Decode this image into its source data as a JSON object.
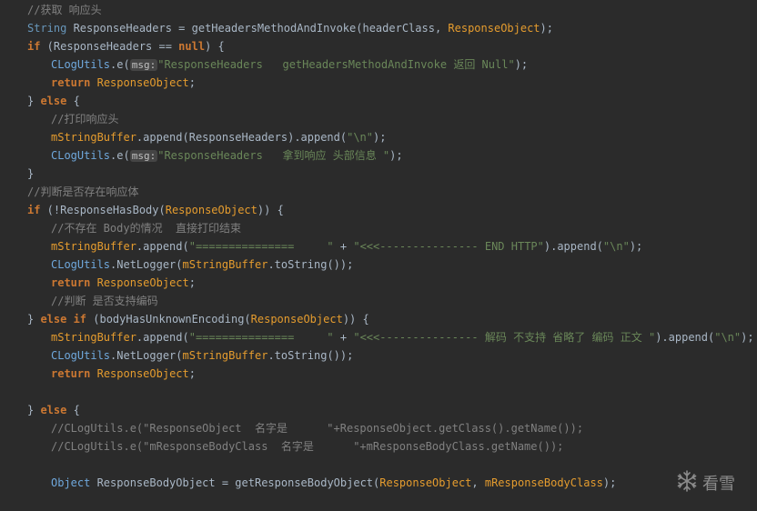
{
  "lines": [
    {
      "ind": 1,
      "tokens": [
        {
          "c": "comment",
          "t": "//获取 响应头"
        }
      ]
    },
    {
      "ind": 1,
      "tokens": [
        {
          "c": "type",
          "t": "String"
        },
        {
          "c": "plain",
          "t": " ResponseHeaders = getHeadersMethodAndInvoke(headerClass, "
        },
        {
          "c": "member",
          "t": "ResponseObject"
        },
        {
          "c": "plain",
          "t": ");"
        }
      ]
    },
    {
      "ind": 1,
      "tokens": [
        {
          "c": "kw",
          "t": "if"
        },
        {
          "c": "plain",
          "t": " (ResponseHeaders == "
        },
        {
          "c": "kw",
          "t": "null"
        },
        {
          "c": "plain",
          "t": ") {"
        }
      ]
    },
    {
      "ind": 2,
      "tokens": [
        {
          "c": "class",
          "t": "CLogUtils"
        },
        {
          "c": "plain",
          "t": ".e("
        },
        {
          "c": "hint",
          "t": "msg:"
        },
        {
          "c": "str",
          "t": "\"ResponseHeaders   getHeadersMethodAndInvoke 返回 Null\""
        },
        {
          "c": "plain",
          "t": ");"
        }
      ]
    },
    {
      "ind": 2,
      "tokens": [
        {
          "c": "kw",
          "t": "return"
        },
        {
          "c": "plain",
          "t": " "
        },
        {
          "c": "member",
          "t": "ResponseObject"
        },
        {
          "c": "plain",
          "t": ";"
        }
      ]
    },
    {
      "ind": 1,
      "tokens": [
        {
          "c": "plain",
          "t": "} "
        },
        {
          "c": "kw",
          "t": "else"
        },
        {
          "c": "plain",
          "t": " {"
        }
      ]
    },
    {
      "ind": 2,
      "tokens": [
        {
          "c": "comment",
          "t": "//打印响应头"
        }
      ]
    },
    {
      "ind": 2,
      "tokens": [
        {
          "c": "member",
          "t": "mStringBuffer"
        },
        {
          "c": "plain",
          "t": ".append(ResponseHeaders).append("
        },
        {
          "c": "str",
          "t": "\"\\n\""
        },
        {
          "c": "plain",
          "t": ");"
        }
      ]
    },
    {
      "ind": 2,
      "tokens": [
        {
          "c": "class",
          "t": "CLogUtils"
        },
        {
          "c": "plain",
          "t": ".e("
        },
        {
          "c": "hint",
          "t": "msg:"
        },
        {
          "c": "str",
          "t": "\"ResponseHeaders   拿到响应 头部信息 \""
        },
        {
          "c": "plain",
          "t": ");"
        }
      ]
    },
    {
      "ind": 1,
      "tokens": [
        {
          "c": "plain",
          "t": "}"
        }
      ]
    },
    {
      "ind": 1,
      "tokens": [
        {
          "c": "comment",
          "t": "//判断是否存在响应体"
        }
      ]
    },
    {
      "ind": 1,
      "tokens": [
        {
          "c": "kw",
          "t": "if"
        },
        {
          "c": "plain",
          "t": " (!ResponseHasBody("
        },
        {
          "c": "member",
          "t": "ResponseObject"
        },
        {
          "c": "plain",
          "t": ")) {"
        }
      ]
    },
    {
      "ind": 2,
      "tokens": [
        {
          "c": "comment",
          "t": "//不存在 Body的情况  直接打印结束"
        }
      ]
    },
    {
      "ind": 2,
      "tokens": [
        {
          "c": "member",
          "t": "mStringBuffer"
        },
        {
          "c": "plain",
          "t": ".append("
        },
        {
          "c": "str",
          "t": "\"===============     \""
        },
        {
          "c": "plain",
          "t": " + "
        },
        {
          "c": "str",
          "t": "\"<<<--------------- END HTTP\""
        },
        {
          "c": "plain",
          "t": ").append("
        },
        {
          "c": "str",
          "t": "\"\\n\""
        },
        {
          "c": "plain",
          "t": ");"
        }
      ]
    },
    {
      "ind": 2,
      "tokens": [
        {
          "c": "class",
          "t": "CLogUtils"
        },
        {
          "c": "plain",
          "t": ".NetLogger("
        },
        {
          "c": "member",
          "t": "mStringBuffer"
        },
        {
          "c": "plain",
          "t": ".toString());"
        }
      ]
    },
    {
      "ind": 2,
      "tokens": [
        {
          "c": "kw",
          "t": "return"
        },
        {
          "c": "plain",
          "t": " "
        },
        {
          "c": "member",
          "t": "ResponseObject"
        },
        {
          "c": "plain",
          "t": ";"
        }
      ]
    },
    {
      "ind": 2,
      "tokens": [
        {
          "c": "comment",
          "t": "//判断 是否支持编码"
        }
      ]
    },
    {
      "ind": 1,
      "tokens": [
        {
          "c": "plain",
          "t": "} "
        },
        {
          "c": "kw",
          "t": "else if"
        },
        {
          "c": "plain",
          "t": " (bodyHasUnknownEncoding("
        },
        {
          "c": "member",
          "t": "ResponseObject"
        },
        {
          "c": "plain",
          "t": ")) {"
        }
      ]
    },
    {
      "ind": 2,
      "tokens": [
        {
          "c": "member",
          "t": "mStringBuffer"
        },
        {
          "c": "plain",
          "t": ".append("
        },
        {
          "c": "str",
          "t": "\"===============     \""
        },
        {
          "c": "plain",
          "t": " + "
        },
        {
          "c": "str",
          "t": "\"<<<--------------- 解码 不支持 省略了 编码 正文 \""
        },
        {
          "c": "plain",
          "t": ").append("
        },
        {
          "c": "str",
          "t": "\"\\n\""
        },
        {
          "c": "plain",
          "t": ");"
        }
      ]
    },
    {
      "ind": 2,
      "tokens": [
        {
          "c": "class",
          "t": "CLogUtils"
        },
        {
          "c": "plain",
          "t": ".NetLogger("
        },
        {
          "c": "member",
          "t": "mStringBuffer"
        },
        {
          "c": "plain",
          "t": ".toString());"
        }
      ]
    },
    {
      "ind": 2,
      "tokens": [
        {
          "c": "kw",
          "t": "return"
        },
        {
          "c": "plain",
          "t": " "
        },
        {
          "c": "member",
          "t": "ResponseObject"
        },
        {
          "c": "plain",
          "t": ";"
        }
      ]
    },
    {
      "ind": 1,
      "tokens": []
    },
    {
      "ind": 1,
      "tokens": [
        {
          "c": "plain",
          "t": "} "
        },
        {
          "c": "kw",
          "t": "else"
        },
        {
          "c": "plain",
          "t": " {"
        }
      ]
    },
    {
      "ind": 2,
      "tokens": [
        {
          "c": "comment",
          "t": "//CLogUtils.e(\"ResponseObject  名字是      \"+ResponseObject.getClass().getName());"
        }
      ]
    },
    {
      "ind": 2,
      "tokens": [
        {
          "c": "comment",
          "t": "//CLogUtils.e(\"mResponseBodyClass  名字是      \"+mResponseBodyClass.getName());"
        }
      ]
    },
    {
      "ind": 1,
      "tokens": []
    },
    {
      "ind": 2,
      "tokens": [
        {
          "c": "class",
          "t": "Object"
        },
        {
          "c": "plain",
          "t": " ResponseBodyObject = getResponseBodyObject("
        },
        {
          "c": "member",
          "t": "ResponseObject"
        },
        {
          "c": "plain",
          "t": ", "
        },
        {
          "c": "member",
          "t": "mResponseBodyClass"
        },
        {
          "c": "plain",
          "t": ");"
        }
      ]
    }
  ],
  "watermark": {
    "icon": "snowflake-icon",
    "text": "看雪"
  },
  "colors": {
    "background": "#2b2b2b",
    "keyword": "#cc7832",
    "string": "#6a8759",
    "member": "#e59c2e",
    "comment": "#808080",
    "class": "#6fa8dc",
    "plain": "#a9b7c6"
  }
}
